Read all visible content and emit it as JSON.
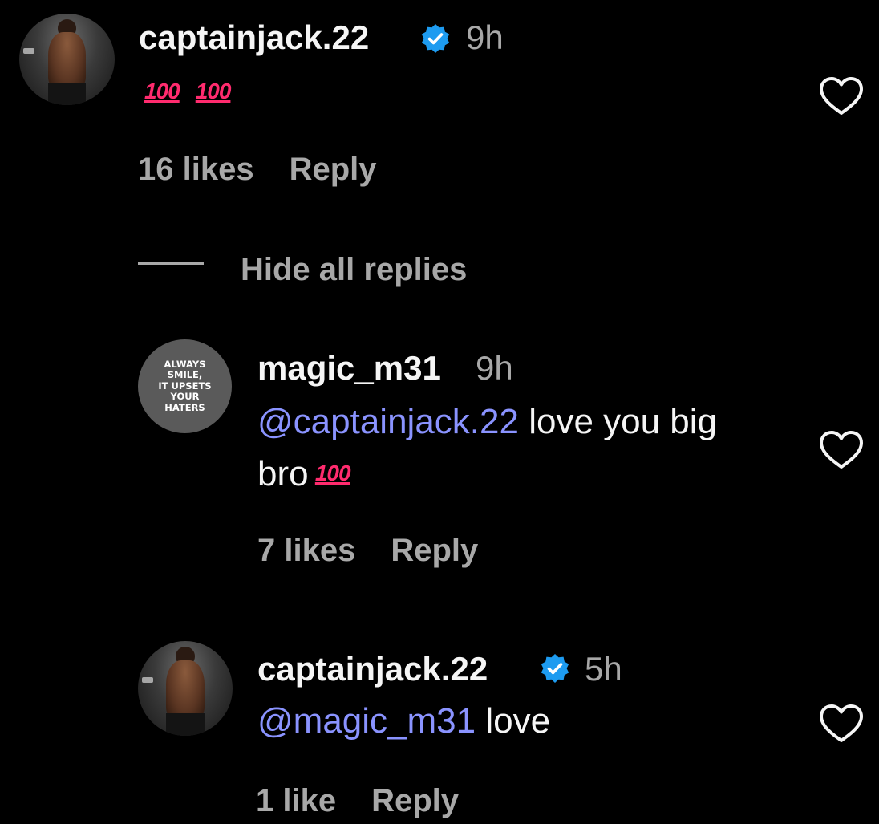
{
  "comments": [
    {
      "username": "captainjack.22",
      "verified": true,
      "time": "9h",
      "mention": "",
      "text": "",
      "emoji": [
        "💯",
        "💯"
      ],
      "emoji_label": "100",
      "likes": "16 likes",
      "reply": "Reply"
    }
  ],
  "hide_replies": "Hide all replies",
  "replies": [
    {
      "username": "magic_m31",
      "verified": false,
      "time": "9h",
      "avatar_text": "ALWAYS\nSMILE,\nIT UPSETS\nYOUR\nHATERS",
      "mention": "@captainjack.22",
      "text_after_mention": " love you big",
      "text_line2": "bro",
      "emoji_label": "100",
      "likes": "7 likes",
      "reply": "Reply"
    },
    {
      "username": "captainjack.22",
      "verified": true,
      "time": "5h",
      "mention": "@magic_m31",
      "text_after_mention": " love",
      "likes": "1 like",
      "reply": "Reply"
    }
  ],
  "icons": {
    "verified": "verified-badge-icon",
    "like": "heart-outline-icon"
  },
  "colors": {
    "background": "#000000",
    "text": "#f5f5f5",
    "secondary": "#a8a8a8",
    "mention": "#8a93ff",
    "verified": "#1d9bf0",
    "emoji": "#ff2b6e"
  }
}
